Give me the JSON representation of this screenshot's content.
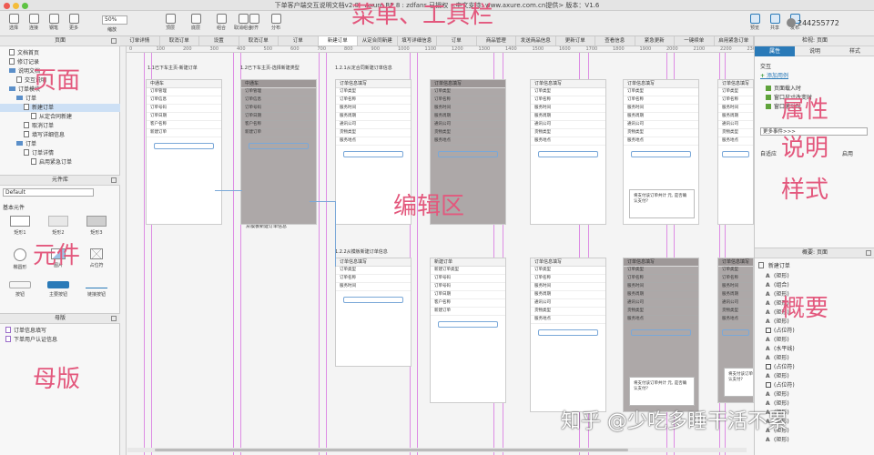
{
  "window": {
    "title": "下单客户端交互说明文档v2.0 - Axure RP 8 : zdfans 已授权  <中文支持: www.axure.com.cn提供> 版本：V1.6",
    "traffic_colors": [
      "#ee5a52",
      "#f4bd3a",
      "#5ec343"
    ]
  },
  "toolbar": {
    "buttons": [
      {
        "label": "选择",
        "icon": "pointer-icon"
      },
      {
        "label": "连接",
        "icon": "connector-icon"
      },
      {
        "label": "钢笔",
        "icon": "pen-icon"
      },
      {
        "label": "更多",
        "icon": "more-icon"
      }
    ],
    "zoom": "50%",
    "zoom_label": "缩放",
    "arrange": [
      {
        "label": "顶层",
        "icon": "bring-front-icon"
      },
      {
        "label": "底层",
        "icon": "send-back-icon"
      },
      {
        "label": "组合",
        "icon": "group-icon"
      },
      {
        "label": "取消组合",
        "icon": "ungroup-icon"
      },
      {
        "label": "对齐",
        "icon": "align-icon"
      },
      {
        "label": "分布",
        "icon": "distribute-icon"
      }
    ],
    "right_buttons": [
      {
        "label": "预览",
        "icon": "preview-icon"
      },
      {
        "label": "共享",
        "icon": "share-icon"
      },
      {
        "label": "发布",
        "icon": "publish-icon"
      }
    ],
    "user": "244255772"
  },
  "pages_panel": {
    "title": "页面",
    "items": [
      {
        "label": "文档首页",
        "type": "page"
      },
      {
        "label": "修订记录",
        "type": "page"
      },
      {
        "label": "说明文档",
        "type": "folder"
      },
      {
        "label": "交互说明",
        "type": "page"
      },
      {
        "label": "订单模块",
        "type": "folder"
      },
      {
        "label": "订单",
        "type": "folder"
      },
      {
        "label": "新建订单",
        "type": "page",
        "selected": true
      },
      {
        "label": "从定合同新建",
        "type": "page"
      },
      {
        "label": "取消订单",
        "type": "page"
      },
      {
        "label": "填写详细信息",
        "type": "page"
      },
      {
        "label": "订单",
        "type": "folder"
      },
      {
        "label": "订单详情",
        "type": "page"
      },
      {
        "label": "启用紧急订单",
        "type": "page"
      }
    ]
  },
  "library_panel": {
    "title": "元件库",
    "selected": "Default",
    "section": "基本元件",
    "widgets": [
      {
        "label": "矩形1",
        "shape": "rect-white"
      },
      {
        "label": "矩形2",
        "shape": "rect-gray"
      },
      {
        "label": "矩形3",
        "shape": "rect-dark"
      },
      {
        "label": "椭圆形",
        "shape": "ellipse"
      },
      {
        "label": "图片",
        "shape": "image"
      },
      {
        "label": "占位符",
        "shape": "placeholder"
      },
      {
        "label": "按钮",
        "shape": "button"
      },
      {
        "label": "主要按钮",
        "shape": "button-primary"
      },
      {
        "label": "链接按钮",
        "shape": "button-link"
      }
    ]
  },
  "masters_panel": {
    "title": "母版",
    "items": [
      "订单信息填写",
      "下单用户认证信息"
    ]
  },
  "doc_tabs": [
    {
      "label": "订单详情"
    },
    {
      "label": "取消订单"
    },
    {
      "label": "设置"
    },
    {
      "label": "取消订单"
    },
    {
      "label": "订单"
    },
    {
      "label": "新建订单",
      "active": true
    },
    {
      "label": "从定合同新建"
    },
    {
      "label": "填写详细信息"
    },
    {
      "label": "订单"
    },
    {
      "label": "商品管理"
    },
    {
      "label": "发送商品信息"
    },
    {
      "label": "更新订单"
    },
    {
      "label": "查看信息"
    },
    {
      "label": "紧急更新"
    },
    {
      "label": "一键续单"
    },
    {
      "label": "启用紧急订单"
    }
  ],
  "ruler": {
    "labels": [
      "0",
      "100",
      "200",
      "300",
      "400",
      "500",
      "600",
      "700",
      "800",
      "900",
      "1000",
      "1100",
      "1200",
      "1300",
      "1400",
      "1500",
      "1600",
      "1700",
      "1800",
      "1900",
      "2000",
      "2100",
      "2200",
      "2300"
    ]
  },
  "canvas": {
    "section_labels": [
      "1.1已下车主页-新建订单",
      "1.2已下车主页-选择新建类型",
      "1.2.1从定合同新建订单信息",
      "1.2.2从模板新建订单信息",
      "从定合同新建订单信息",
      "从模板新建订单信息"
    ],
    "screens": [
      {
        "title": "中通车",
        "rows": [
          "订单管理",
          "订单信息",
          "订单号码",
          "订单日期",
          "客户名称",
          "新建订单"
        ],
        "dim": false
      },
      {
        "title": "中通车",
        "rows": [
          "订单管理",
          "订单信息",
          "订单号码",
          "订单日期",
          "客户名称",
          "新建订单"
        ],
        "dim": true
      },
      {
        "title": "订单信息填写",
        "rows": [
          "订单类型",
          "订单名称",
          "服务时间",
          "服务周期",
          "通讯公司",
          "货物类型",
          "服务地点"
        ],
        "dim": false
      },
      {
        "title": "订单信息填写",
        "rows": [
          "订单类型",
          "订单名称",
          "服务时间",
          "服务周期",
          "通讯公司",
          "货物类型",
          "服务地点"
        ],
        "dim": true
      },
      {
        "title": "订单信息填写",
        "rows": [
          "订单类型",
          "订单名称",
          "服务时间",
          "服务周期",
          "通讯公司",
          "货物类型",
          "服务地点"
        ],
        "dim": false
      },
      {
        "title": "订单信息填写",
        "rows": [
          "订单类型",
          "订单名称",
          "服务时间",
          "服务周期",
          "通讯公司",
          "货物类型",
          "服务地点"
        ],
        "dim": false
      },
      {
        "title": "订单信息填写",
        "rows": [
          "订单类型",
          "订单名称",
          "服务时间",
          "服务周期",
          "通讯公司",
          "货物类型",
          "服务地点"
        ],
        "dim": false
      },
      {
        "title": "订单信息填写",
        "rows": [
          "订单类型",
          "订单名称",
          "服务时间"
        ],
        "dim": false
      },
      {
        "title": "新建订单",
        "rows": [
          "新建订单类型",
          "订单号码",
          "订单号码",
          "订单日期",
          "客户名称",
          "新建订单"
        ],
        "dim": false
      },
      {
        "title": "订单信息填写",
        "rows": [
          "订单类型",
          "订单名称",
          "服务时间",
          "服务周期",
          "通讯公司",
          "货物类型",
          "服务地点"
        ],
        "dim": false
      },
      {
        "title": "订单信息填写",
        "rows": [
          "订单类型",
          "订单名称",
          "服务时间",
          "服务周期",
          "通讯公司",
          "货物类型",
          "服务地点"
        ],
        "dim": true
      },
      {
        "title": "订单信息填写",
        "rows": [
          "订单类型",
          "订单名称",
          "服务时间",
          "服务周期",
          "通讯公司",
          "货物类型",
          "服务地点"
        ],
        "dim": true
      }
    ],
    "dialog_text": "将支付该订单共计 元, 是否确认支付?"
  },
  "inspector": {
    "title": "检视: 页面",
    "tabs": [
      "属性",
      "说明",
      "样式"
    ],
    "section": "交互",
    "add_case": "添加用例",
    "events": [
      "页面载入时",
      "窗口尺寸改变时",
      "窗口滚动时"
    ],
    "more_events": "更多事件>>>",
    "adaptive_label": "自适应",
    "adaptive_value": "启用"
  },
  "outline_panel": {
    "title": "概要: 页面",
    "root": "新建订单",
    "items": [
      "(矩形)",
      "(组合)",
      "(矩形)",
      "(矩形)",
      "(矩形)",
      "(矩形)",
      "(占位符)",
      "(矩形)",
      "(水平线)",
      "(矩形)",
      "(占位符)",
      "(矩形)",
      "(占位符)",
      "(矩形)",
      "(矩形)",
      "(矩形)",
      "(矩形)",
      "(矩形)",
      "(矩形)"
    ]
  },
  "annotations": {
    "menu_toolbar": "菜单、工具栏",
    "pages": "页面",
    "widgets": "元件",
    "masters": "母版",
    "edit_area": "编辑区",
    "properties": "属性",
    "notes": "说明",
    "style": "样式",
    "outline": "概要"
  },
  "watermark": "知乎 @少吃多睡干活不累"
}
